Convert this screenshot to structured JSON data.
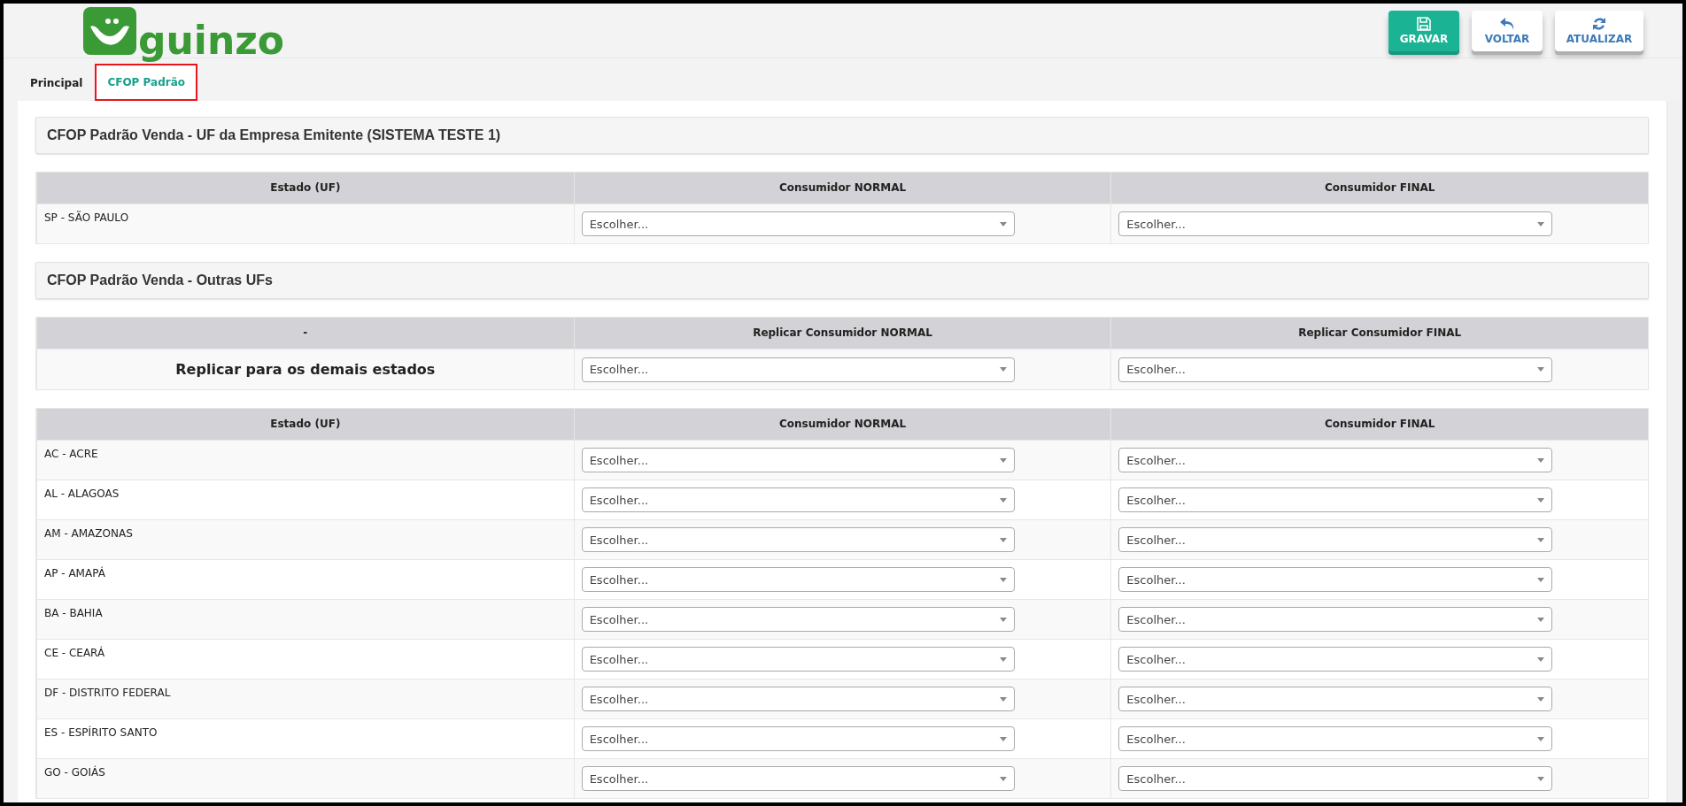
{
  "header": {
    "logo_text": "guinzo",
    "buttons": [
      {
        "label": "GRAVAR",
        "kind": "save"
      },
      {
        "label": "VOLTAR",
        "kind": "back"
      },
      {
        "label": "ATUALIZAR",
        "kind": "refresh"
      }
    ]
  },
  "tabs": [
    {
      "label": "Principal",
      "selected": false
    },
    {
      "label": "CFOP Padrão",
      "selected": true
    }
  ],
  "sections": [
    {
      "title": "CFOP Padrão Venda - UF da Empresa Emitente (SISTEMA TESTE 1)",
      "tables": [
        {
          "columns": [
            "Estado (UF)",
            "Consumidor NORMAL",
            "Consumidor FINAL"
          ],
          "rows": [
            {
              "kind": "state",
              "label": "SP - SÃO PAULO",
              "selects": [
                {
                  "placeholder": "Escolher..."
                },
                {
                  "placeholder": "Escolher..."
                }
              ]
            }
          ]
        }
      ]
    },
    {
      "title": "CFOP Padrão Venda - Outras UFs",
      "tables": [
        {
          "columns": [
            "-",
            "Replicar Consumidor NORMAL",
            "Replicar Consumidor FINAL"
          ],
          "rows": [
            {
              "kind": "replicate",
              "label": "Replicar para os demais estados",
              "selects": [
                {
                  "placeholder": "Escolher..."
                },
                {
                  "placeholder": "Escolher..."
                }
              ]
            }
          ]
        },
        {
          "columns": [
            "Estado (UF)",
            "Consumidor NORMAL",
            "Consumidor FINAL"
          ],
          "rows": [
            {
              "kind": "state",
              "label": "AC - ACRE",
              "selects": [
                {
                  "placeholder": "Escolher..."
                },
                {
                  "placeholder": "Escolher..."
                }
              ]
            },
            {
              "kind": "state",
              "label": "AL - ALAGOAS",
              "selects": [
                {
                  "placeholder": "Escolher..."
                },
                {
                  "placeholder": "Escolher..."
                }
              ]
            },
            {
              "kind": "state",
              "label": "AM - AMAZONAS",
              "selects": [
                {
                  "placeholder": "Escolher..."
                },
                {
                  "placeholder": "Escolher..."
                }
              ]
            },
            {
              "kind": "state",
              "label": "AP - AMAPÁ",
              "selects": [
                {
                  "placeholder": "Escolher..."
                },
                {
                  "placeholder": "Escolher..."
                }
              ]
            },
            {
              "kind": "state",
              "label": "BA - BAHIA",
              "selects": [
                {
                  "placeholder": "Escolher..."
                },
                {
                  "placeholder": "Escolher..."
                }
              ]
            },
            {
              "kind": "state",
              "label": "CE - CEARÁ",
              "selects": [
                {
                  "placeholder": "Escolher..."
                },
                {
                  "placeholder": "Escolher..."
                }
              ]
            },
            {
              "kind": "state",
              "label": "DF - DISTRITO FEDERAL",
              "selects": [
                {
                  "placeholder": "Escolher..."
                },
                {
                  "placeholder": "Escolher..."
                }
              ]
            },
            {
              "kind": "state",
              "label": "ES - ESPÍRITO SANTO",
              "selects": [
                {
                  "placeholder": "Escolher..."
                },
                {
                  "placeholder": "Escolher..."
                }
              ]
            },
            {
              "kind": "state",
              "label": "GO - GOIÁS",
              "selects": [
                {
                  "placeholder": "Escolher..."
                },
                {
                  "placeholder": "Escolher..."
                }
              ]
            }
          ]
        }
      ]
    }
  ]
}
